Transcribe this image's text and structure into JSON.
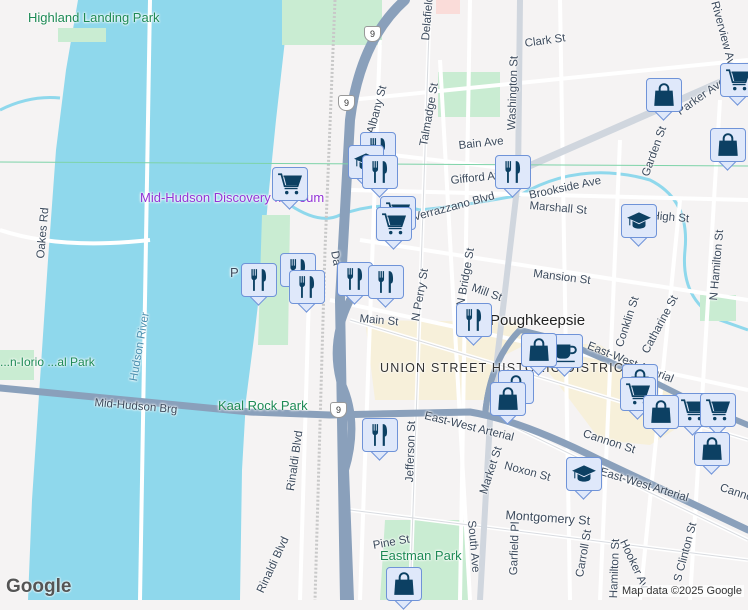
{
  "map": {
    "colors": {
      "water": "#8fd8ec",
      "land": "#f5f3f3",
      "park": "#c9ecd2",
      "highway": "#8aa0bb",
      "marker_fill": "#dfe8fa",
      "marker_border": "#6f93d8",
      "marker_icon": "#0c4063"
    },
    "parks": {
      "highland": "Highland Landing Park",
      "kaal": "Kaal Rock Park",
      "eastman": "Eastman Park",
      "bonn": "...n-Iorio ...al Park",
      "p_label": "P"
    },
    "poi": {
      "museum": "Mid-Hudson Discovery Museum"
    },
    "water": {
      "river": "Hudson River"
    },
    "district": "UNION STREET HISTORIC DISTRICT",
    "city": "Poughkeepsie",
    "route_shield": "9",
    "streets": {
      "oakes": "Oakes Rd",
      "bridge": "Mid-Hudson Brg",
      "rinaldi": "Rinaldi Blvd",
      "rinaldi2": "Rinaldi Blvd",
      "delafield": "Delafield",
      "clark": "Clark St",
      "washington": "Washington St",
      "talmadge": "Talmadge St",
      "bain": "Bain Ave",
      "gifford": "Gifford Av",
      "brookside": "Brookside Ave",
      "verazzano": "Verrazzano Blvd",
      "marshall": "Marshall St",
      "garden": "Garden St",
      "parker": "Parker Ave",
      "mansion": "Mansion St",
      "mill": "Mill St",
      "nperry": "N Perry St",
      "nbridge": "N Bridge St",
      "main": "Main St",
      "conklin": "Conklin St",
      "catharine": "Catharine St",
      "nhamilton": "N Hamilton St",
      "ewa1": "East-West Arterial",
      "ewa2": "East-West Arterial",
      "ewa3": "East-West Arterial",
      "cannon": "Cannon St",
      "cannon2": "Cannon St",
      "noxon": "Noxon St",
      "market": "Market St",
      "jefferson": "Jefferson St",
      "montgomery": "Montgomery St",
      "pine": "Pine St",
      "southave": "South Ave",
      "garfield": "Garfield Pl",
      "carroll": "Carroll St",
      "hamilton": "Hamilton St",
      "hooker": "Hooker Av",
      "sclinton": "S Clinton St",
      "albany": "Albany St",
      "riverview": "Riverview Ave",
      "high": "High St",
      "dutchess": "Da"
    },
    "markers": [
      "cart",
      "utensils",
      "bag",
      "cart",
      "bag",
      "graduation-cap",
      "utensils",
      "graduation-cap",
      "utensils",
      "cart",
      "cart",
      "utensils",
      "utensils",
      "utensils",
      "utensils",
      "utensils",
      "utensils",
      "coffee",
      "bag",
      "bag",
      "bag",
      "bag",
      "cart",
      "cart",
      "bag",
      "cart",
      "bag",
      "graduation-cap",
      "utensils",
      "bag"
    ],
    "google_logo": "Google",
    "attribution": "Map data ©2025 Google"
  }
}
